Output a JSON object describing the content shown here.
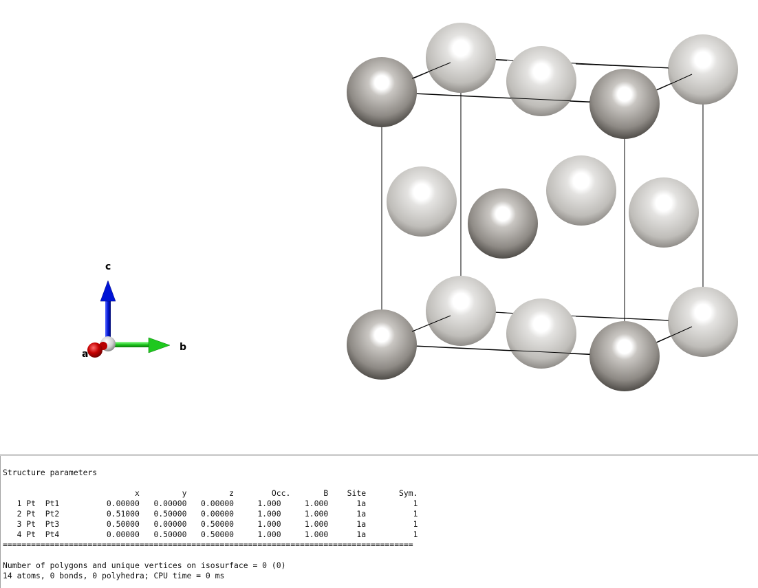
{
  "viewer": {
    "axes": {
      "a_label": "a",
      "b_label": "b",
      "c_label": "c"
    },
    "colors": {
      "axis_a": "#c40000",
      "axis_b": "#1ec81e",
      "axis_c": "#0014d6",
      "atom_back": "#c8c6c3",
      "atom_front": "#8a8783",
      "cell_edge": "#000000"
    },
    "structure": {
      "element": "Pt",
      "atom_count": 14,
      "cell_shape": "cubic"
    }
  },
  "log": {
    "title": "Structure parameters",
    "columns": [
      "x",
      "y",
      "z",
      "Occ.",
      "B",
      "Site",
      "Sym."
    ],
    "atoms": [
      {
        "index": "1",
        "element": "Pt",
        "label": "Pt1",
        "x": "0.00000",
        "y": "0.00000",
        "z": "0.00000",
        "occ": "1.000",
        "b": "1.000",
        "site": "1a",
        "sym": "1"
      },
      {
        "index": "2",
        "element": "Pt",
        "label": "Pt2",
        "x": "0.51000",
        "y": "0.50000",
        "z": "0.00000",
        "occ": "1.000",
        "b": "1.000",
        "site": "1a",
        "sym": "1"
      },
      {
        "index": "3",
        "element": "Pt",
        "label": "Pt3",
        "x": "0.50000",
        "y": "0.00000",
        "z": "0.50000",
        "occ": "1.000",
        "b": "1.000",
        "site": "1a",
        "sym": "1"
      },
      {
        "index": "4",
        "element": "Pt",
        "label": "Pt4",
        "x": "0.00000",
        "y": "0.50000",
        "z": "0.50000",
        "occ": "1.000",
        "b": "1.000",
        "site": "1a",
        "sym": "1"
      }
    ],
    "separator_char": "=",
    "isosurface_line": "Number of polygons and unique vertices on isosurface = 0 (0)",
    "summary_line": "14 atoms, 0 bonds, 0 polyhedra; CPU time = 0 ms"
  }
}
